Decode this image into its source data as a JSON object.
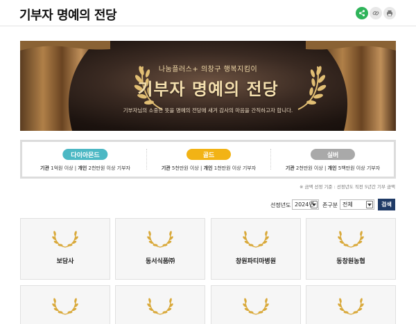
{
  "header": {
    "title": "기부자 명예의 전당",
    "buttons": [
      {
        "name": "share",
        "icon": "share-icon",
        "color": "#2fb45a"
      },
      {
        "name": "link",
        "icon": "link-icon"
      },
      {
        "name": "print",
        "icon": "print-icon"
      }
    ]
  },
  "banner": {
    "subtitle": "나눔플러스+ 의창구 행복지킴이",
    "title": "기부자 명예의 전당",
    "description": "기부자님의 소중한 뜻을 명예의 전당에 새겨 감사의 마음을 간직하고자 합니다."
  },
  "grades": [
    {
      "label": "다이아몬드",
      "color": "#4cb8c4",
      "org_label": "기관",
      "org_value": " 1억원 이상 | ",
      "ind_label": "개인",
      "ind_value": " 2천만원 이상 기부자"
    },
    {
      "label": "골드",
      "color": "#f2b315",
      "org_label": "기관",
      "org_value": " 5천만원 이상 | ",
      "ind_label": "개인",
      "ind_value": " 1천만원 이상 기부자"
    },
    {
      "label": "실버",
      "color": "#a9a9a9",
      "org_label": "기관",
      "org_value": " 2천만원 이상 | ",
      "ind_label": "개인",
      "ind_value": " 5백만원 이상 기부자"
    }
  ],
  "notice": "※ 금액 선정 기준 : 선정년도 직전 5년간 기부 금액",
  "search": {
    "year_label": "선정년도",
    "year_value": "2024년",
    "area_label": "존구분",
    "area_value": "전체",
    "button_label": "검색"
  },
  "donors": [
    {
      "name": "보담사"
    },
    {
      "name": "동서식품㈜"
    },
    {
      "name": "창원파티마병원"
    },
    {
      "name": "동창원농협"
    },
    {
      "name": ""
    },
    {
      "name": ""
    },
    {
      "name": ""
    },
    {
      "name": ""
    }
  ]
}
